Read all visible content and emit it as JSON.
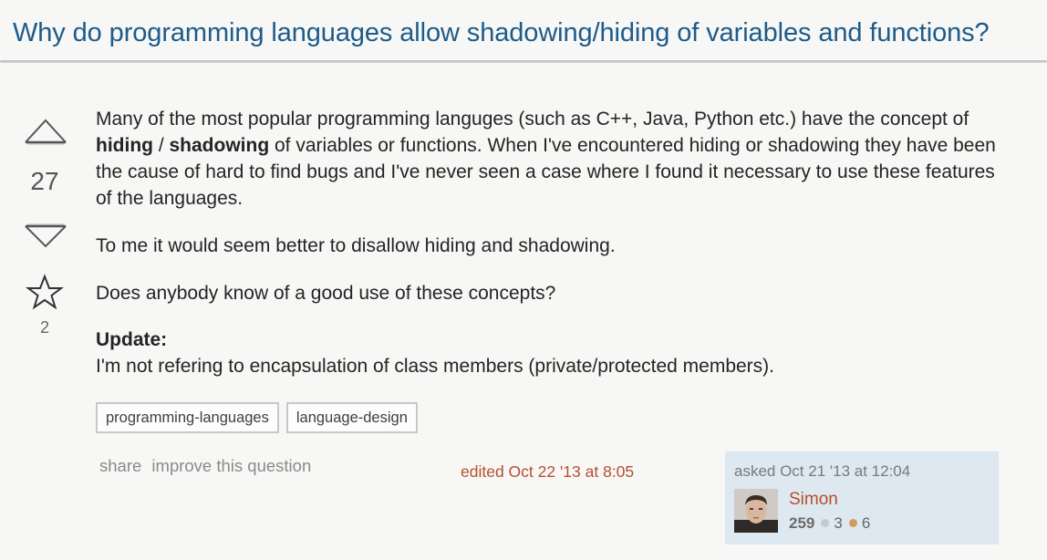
{
  "question": {
    "title": "Why do programming languages allow shadowing/hiding of variables and functions?",
    "votes": "27",
    "favorites": "2",
    "body": {
      "p1_before": "Many of the most popular programming languges (such as C++, Java, Python etc.) have the concept of ",
      "p1_bold1": "hiding",
      "p1_sep": " / ",
      "p1_bold2": "shadowing",
      "p1_after": " of variables or functions. When I've encountered hiding or shadowing they have been the cause of hard to find bugs and I've never seen a case where I found it necessary to use these features of the languages.",
      "p2": "To me it would seem better to disallow hiding and shadowing.",
      "p3": "Does anybody know of a good use of these concepts?",
      "update_heading": "Update:",
      "update_text": "I'm not refering to encapsulation of class members (private/protected members)."
    },
    "tags": [
      "programming-languages",
      "language-design"
    ]
  },
  "menu": {
    "share": "share",
    "improve": "improve this question"
  },
  "edited": "edited Oct 22 '13 at 8:05",
  "owner": {
    "asked": "asked Oct 21 '13 at 12:04",
    "name": "Simon",
    "reputation": "259",
    "silver": "3",
    "bronze": "6"
  },
  "colors": {
    "title": "#1d5b8a",
    "link_orange": "#b5502d",
    "owner_bg": "#dde8f0",
    "silver_badge": "#c8c8c8",
    "bronze_badge": "#d29c5b"
  },
  "icons": [
    "upvote-arrow-icon",
    "downvote-arrow-icon",
    "favorite-star-icon"
  ]
}
